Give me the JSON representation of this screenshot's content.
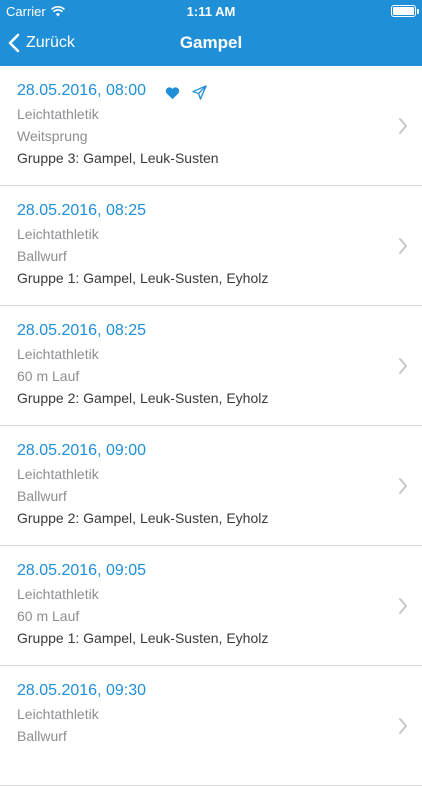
{
  "status_bar": {
    "carrier": "Carrier",
    "time": "1:11 AM"
  },
  "nav": {
    "back_label": "Zurück",
    "title": "Gampel"
  },
  "colors": {
    "accent": "#1f8fd8"
  },
  "icons": {
    "favorite": "heart-icon",
    "share": "paper-plane-icon",
    "disclosure": "chevron-right-icon"
  },
  "events": [
    {
      "datetime": "28.05.2016, 08:00",
      "sport": "Leichtathletik",
      "discipline": "Weitsprung",
      "group": "Gruppe 3: Gampel, Leuk-Susten"
    },
    {
      "datetime": "28.05.2016, 08:25",
      "sport": "Leichtathletik",
      "discipline": "Ballwurf",
      "group": "Gruppe 1: Gampel, Leuk-Susten, Eyholz"
    },
    {
      "datetime": "28.05.2016, 08:25",
      "sport": "Leichtathletik",
      "discipline": "60 m Lauf",
      "group": "Gruppe 2: Gampel, Leuk-Susten, Eyholz"
    },
    {
      "datetime": "28.05.2016, 09:00",
      "sport": "Leichtathletik",
      "discipline": "Ballwurf",
      "group": "Gruppe 2: Gampel, Leuk-Susten, Eyholz"
    },
    {
      "datetime": "28.05.2016, 09:05",
      "sport": "Leichtathletik",
      "discipline": "60 m Lauf",
      "group": "Gruppe 1: Gampel, Leuk-Susten, Eyholz"
    },
    {
      "datetime": "28.05.2016, 09:30",
      "sport": "Leichtathletik",
      "discipline": "Ballwurf",
      "group": ""
    }
  ]
}
